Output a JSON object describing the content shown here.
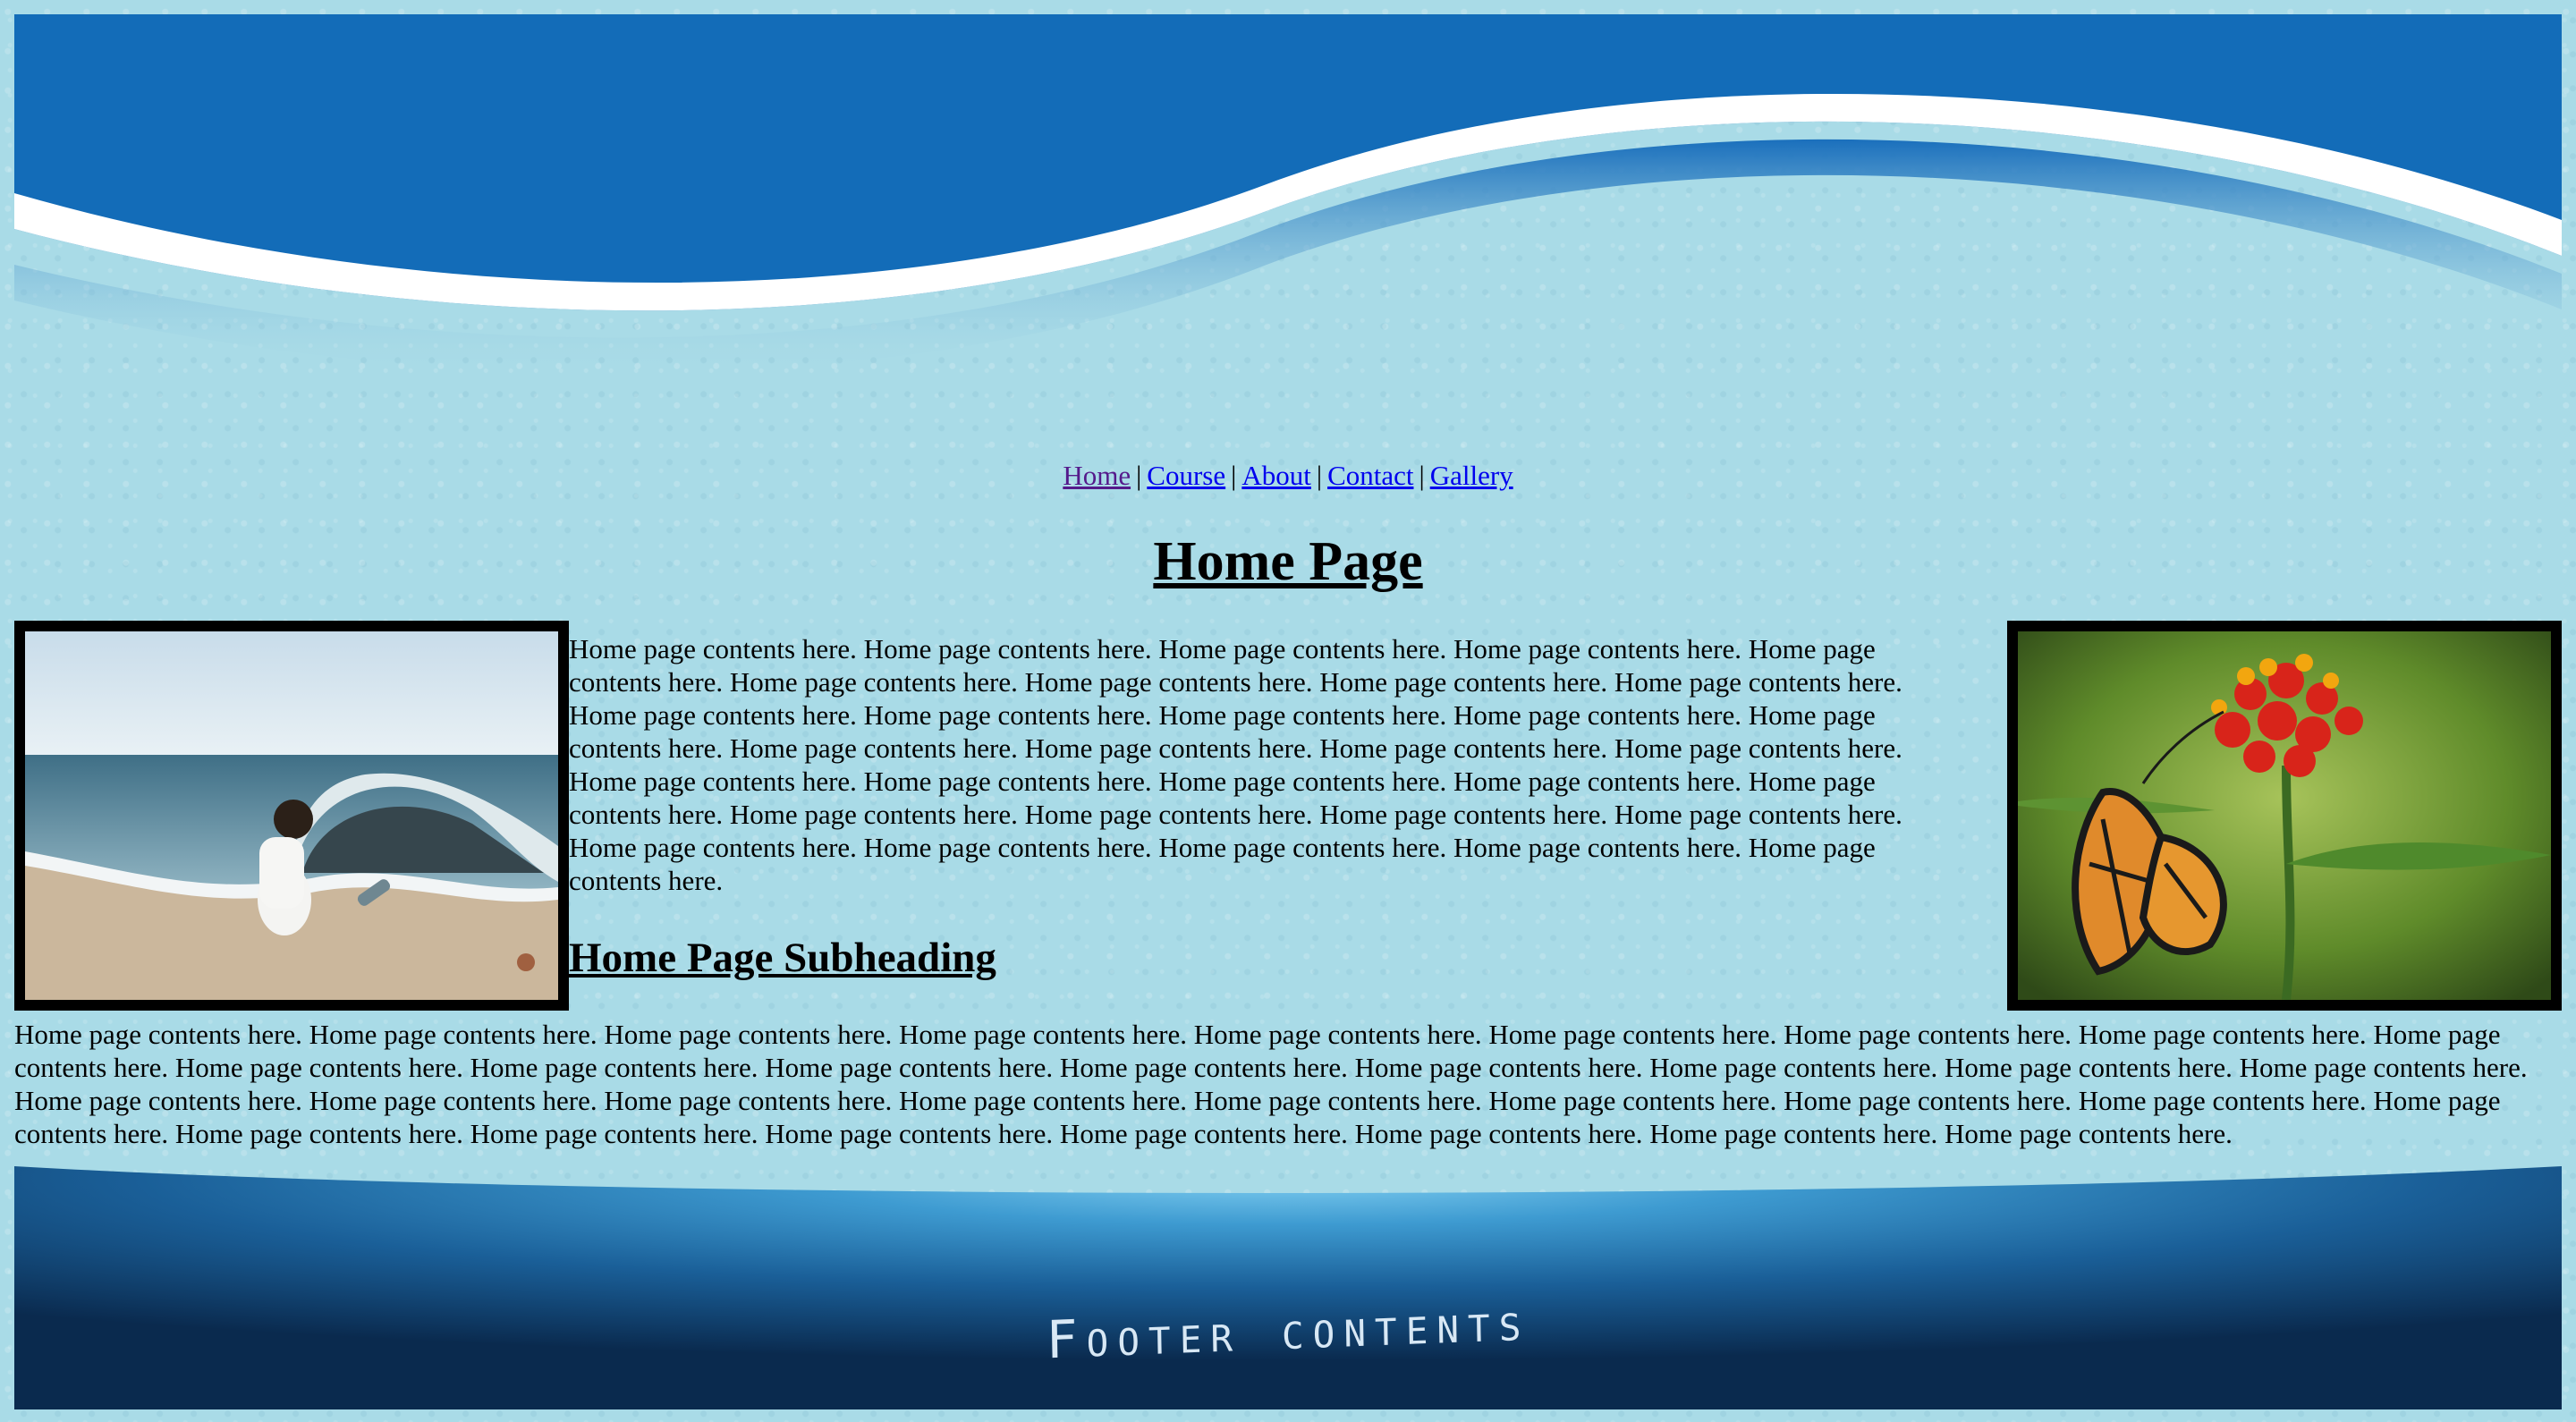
{
  "nav": {
    "items": [
      {
        "label": "Home",
        "visited": true
      },
      {
        "label": "Course"
      },
      {
        "label": "About"
      },
      {
        "label": "Contact"
      },
      {
        "label": "Gallery"
      }
    ],
    "separator": "|"
  },
  "main": {
    "title": "Home Page",
    "paragraph1": "Home page contents here. Home page contents here. Home page contents here. Home page contents here. Home page contents here. Home page contents here. Home page contents here. Home page contents here. Home page contents here. Home page contents here. Home page contents here. Home page contents here. Home page contents here. Home page contents here. Home page contents here. Home page contents here. Home page contents here. Home page contents here. Home page contents here. Home page contents here. Home page contents here. Home page contents here. Home page contents here. Home page contents here. Home page contents here. Home page contents here. Home page contents here. Home page contents here. Home page contents here. Home page contents here. Home page contents here. Home page contents here.",
    "subheading": "Home Page Subheading",
    "paragraph2": "Home page contents here. Home page contents here. Home page contents here. Home page contents here. Home page contents here. Home page contents here. Home page contents here. Home page contents here. Home page contents here. Home page contents here. Home page contents here. Home page contents here. Home page contents here. Home page contents here. Home page contents here. Home page contents here. Home page contents here. Home page contents here. Home page contents here. Home page contents here. Home page contents here. Home page contents here. Home page contents here. Home page contents here. Home page contents here. Home page contents here. Home page contents here. Home page contents here. Home page contents here. Home page contents here. Home page contents here. Home page contents here. Home page contents here."
  },
  "footer": {
    "text": "Footer contents"
  },
  "colors": {
    "background": "#a9dbe7",
    "banner_blue": "#136cb8",
    "link": "#0000ee",
    "link_visited": "#551a8b"
  }
}
